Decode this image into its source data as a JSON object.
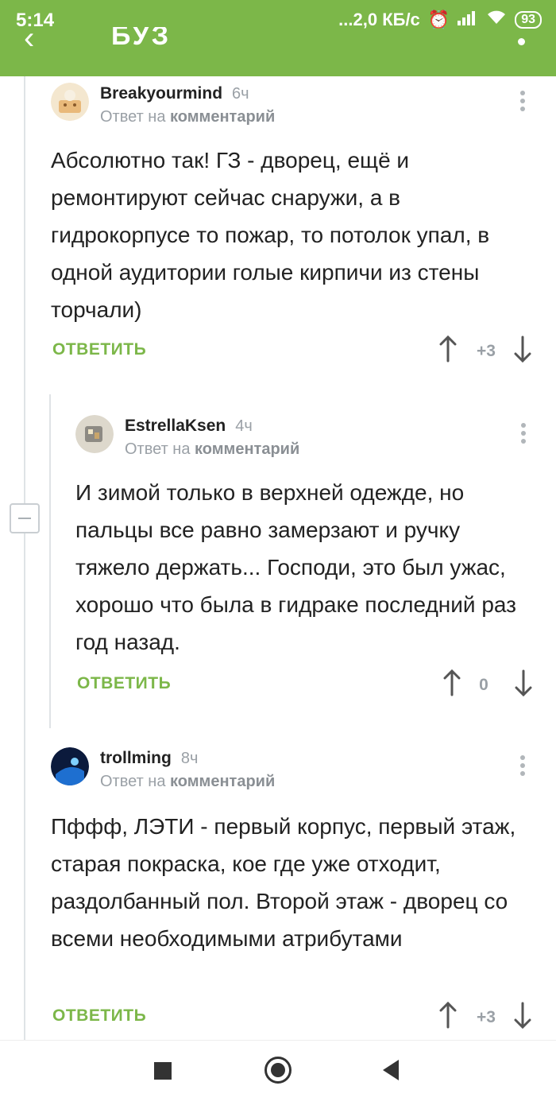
{
  "status_bar": {
    "time": "5:14",
    "network_speed": "...2,0 КБ/с",
    "battery": "93"
  },
  "appbar": {
    "title_fragment": "БУЗ"
  },
  "colors": {
    "accent": "#7cb749",
    "text": "#222222",
    "muted": "#9aa0a6"
  },
  "comments": [
    {
      "username": "Breakyourmind",
      "time": "6ч",
      "reply_prefix": "Ответ на",
      "reply_target": "комментарий",
      "text": "Абсолютно так! ГЗ - дворец, ещё и ремонтируют сейчас снаружи, а в гидрокорпусе то пожар, то потолок упал, в одной аудитории голые кирпичи из стены торчали)",
      "reply_label": "ОТВЕТИТЬ",
      "rating": "+3"
    },
    {
      "username": "EstrellaKsen",
      "time": "4ч",
      "reply_prefix": "Ответ на",
      "reply_target": "комментарий",
      "text": "И зимой только в верхней одежде, но пальцы все равно замерзают и ручку тяжело держать... Господи, это был ужас, хорошо что была в гидраке последний раз год назад.",
      "reply_label": "ОТВЕТИТЬ",
      "rating": "0"
    },
    {
      "username": "trollming",
      "time": "8ч",
      "reply_prefix": "Ответ на",
      "reply_target": "комментарий",
      "text": "Пффф, ЛЭТИ - первый корпус, первый этаж, старая покраска, кое где уже отходит, раздолбанный пол. Второй этаж - дворец со всеми необходимыми атрибутами",
      "reply_label": "ОТВЕТИТЬ",
      "rating": "+3"
    }
  ]
}
